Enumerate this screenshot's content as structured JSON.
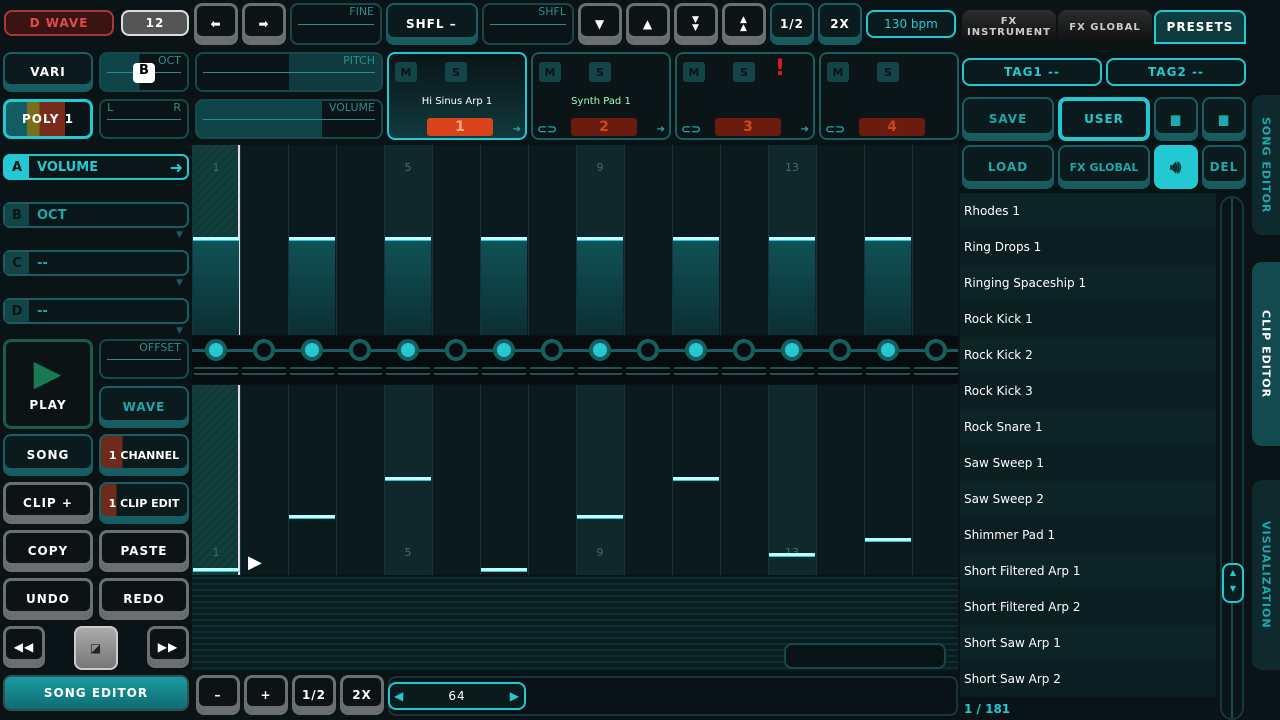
{
  "top": {
    "wave": "D WAVE",
    "octave_value": "12",
    "fine": "FINE",
    "shuffle_button": "SHFL –",
    "shuffle_slider": "SHFL",
    "half": "1/2",
    "double": "2X",
    "bpm": "130 bpm"
  },
  "row2": {
    "vari": "VARI",
    "oct": "OCT",
    "oct_badge": "B",
    "pitch": "PITCH",
    "poly": "POLY 1",
    "pan_l": "L",
    "pan_r": "R",
    "volume": "VOLUME",
    "volume_level": 0.7
  },
  "tracks": [
    {
      "m": "M",
      "s": "S",
      "name": "Hi Sinus Arp 1",
      "num": "1",
      "active": true
    },
    {
      "m": "M",
      "s": "S",
      "name": "Synth Pad 1",
      "num": "2"
    },
    {
      "m": "M",
      "s": "S",
      "name": "",
      "num": "3",
      "warning": "!"
    },
    {
      "m": "M",
      "s": "S",
      "name": "",
      "num": "4"
    }
  ],
  "params": [
    {
      "letter": "A",
      "value": "VOLUME"
    },
    {
      "letter": "B",
      "value": "OCT"
    },
    {
      "letter": "C",
      "value": "--"
    },
    {
      "letter": "D",
      "value": "--"
    }
  ],
  "controls": {
    "offset": "OFFSET",
    "play": "PLAY",
    "wave": "WAVE",
    "song": "SONG",
    "channel": "1 CHANNEL",
    "clip_plus": "CLIP +",
    "clip_edit": "1 CLIP EDIT",
    "copy": "COPY",
    "paste": "PASTE",
    "undo": "UNDO",
    "redo": "REDO",
    "song_editor": "SONG EDITOR"
  },
  "grid": {
    "beat_labels": [
      "1",
      "5",
      "9",
      "13"
    ],
    "upper_values": [
      0.5,
      0,
      0.5,
      0,
      0.5,
      0,
      0.5,
      0,
      0.5,
      0,
      0.5,
      0,
      0.5,
      0,
      0.5,
      0
    ],
    "lower_values": [
      0.02,
      0,
      0.3,
      0,
      0.5,
      0,
      0.02,
      0,
      0.3,
      0,
      0.5,
      0,
      0.1,
      0,
      0.18,
      0
    ],
    "steps_on": [
      1,
      0,
      1,
      0,
      1,
      0,
      1,
      0,
      1,
      0,
      1,
      0,
      1,
      0,
      1,
      0
    ]
  },
  "bottom": {
    "minus": "–",
    "plus": "+",
    "half": "1/2",
    "double": "2X",
    "length": "64"
  },
  "right": {
    "tabs": [
      {
        "label": "FX INSTRUMENT"
      },
      {
        "label": "FX GLOBAL"
      },
      {
        "label": "PRESETS",
        "active": true
      }
    ],
    "tag1": "TAG1 --",
    "tag2": "TAG2 --",
    "save": "SAVE",
    "user": "USER",
    "load": "LOAD",
    "fx_global": "FX GLOBAL",
    "del": "DEL",
    "presets": [
      "Rhodes 1",
      "Ring Drops 1",
      "Ringing Spaceship 1",
      "Rock Kick 1",
      "Rock Kick 2",
      "Rock Kick 3",
      "Rock Snare 1",
      "Saw Sweep 1",
      "Saw Sweep 2",
      "Shimmer Pad 1",
      "Short Filtered Arp 1",
      "Short Filtered Arp 2",
      "Short Saw Arp 1",
      "Short Saw Arp 2"
    ],
    "page": "1 / 181"
  },
  "side_tabs": [
    "SONG EDITOR",
    "CLIP EDITOR",
    "VISUALIZATION"
  ],
  "colors": {
    "accent": "#22c9d3",
    "teal": "#175d62",
    "red": "#c8481f"
  }
}
